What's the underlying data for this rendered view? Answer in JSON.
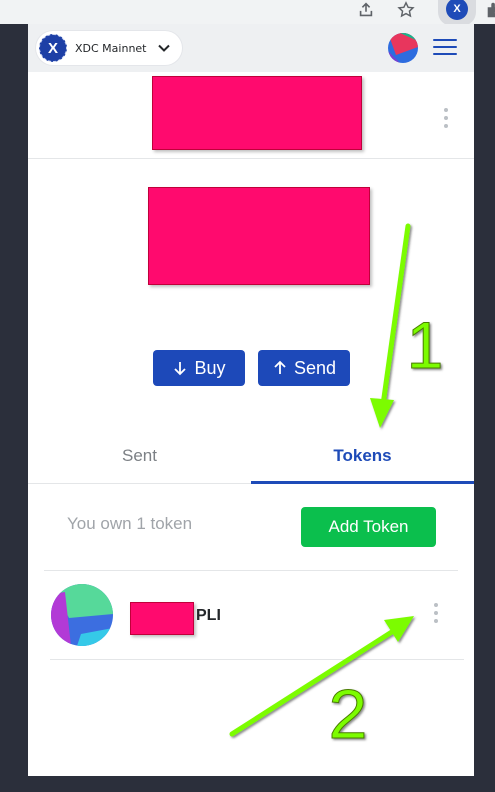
{
  "network": {
    "name": "XDC Mainnet",
    "logo_letter": "X"
  },
  "browser": {
    "extension_letter": "X"
  },
  "actions": {
    "buy": "Buy",
    "send": "Send"
  },
  "tabs": {
    "sent": "Sent",
    "tokens": "Tokens"
  },
  "tokens_section": {
    "own_text": "You own 1 token",
    "add_token": "Add Token",
    "items": [
      {
        "symbol": "PLI"
      }
    ]
  },
  "annotations": {
    "one": "1",
    "two": "2"
  },
  "colors": {
    "primary": "#1e4bb8",
    "success": "#0bbf4d",
    "redaction": "#ff0a6e",
    "annotation": "#7cfc00"
  }
}
